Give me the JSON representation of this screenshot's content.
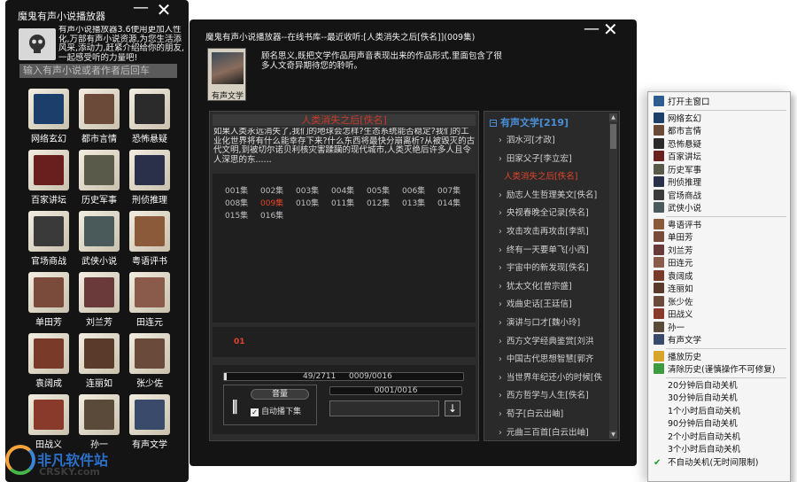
{
  "launcher": {
    "title": "魔鬼有声小说播放器",
    "intro": "有声小说播放器3.6使用更加人性化,万部有声小说资源,为您生活添风采,添动力,赶紧介绍给你的朋友,一起感受听的力量吧!",
    "search_placeholder": "输入有声小说或者作者后回车",
    "categories": [
      {
        "label": "网络玄幻",
        "icon": "fantasy-icon",
        "color": "#1b3f6a"
      },
      {
        "label": "都市言情",
        "icon": "romance-icon",
        "color": "#6b4a3a"
      },
      {
        "label": "恐怖悬疑",
        "icon": "skull-icon",
        "color": "#2b2b2b"
      },
      {
        "label": "百家讲坛",
        "icon": "lecture-icon",
        "color": "#6a1f1f"
      },
      {
        "label": "历史军事",
        "icon": "history-icon",
        "color": "#5a5a4a"
      },
      {
        "label": "刑侦推理",
        "icon": "police-icon",
        "color": "#2a2f4a"
      },
      {
        "label": "官场商战",
        "icon": "business-icon",
        "color": "#3a3a3a"
      },
      {
        "label": "武侠小说",
        "icon": "martial-arts-icon",
        "color": "#4a5a5a"
      },
      {
        "label": "粤语评书",
        "icon": "cantonese-icon",
        "color": "#8a5a3a"
      },
      {
        "label": "单田芳",
        "icon": "narrator-icon",
        "color": "#7a4a3a"
      },
      {
        "label": "刘兰芳",
        "icon": "narrator-icon",
        "color": "#6a3a3a"
      },
      {
        "label": "田连元",
        "icon": "narrator-icon",
        "color": "#8a5a4a"
      },
      {
        "label": "袁阔成",
        "icon": "narrator-icon",
        "color": "#7a3a2a"
      },
      {
        "label": "连丽如",
        "icon": "narrator-icon",
        "color": "#5a3a2a"
      },
      {
        "label": "张少佐",
        "icon": "narrator-icon",
        "color": "#6a4a3a"
      },
      {
        "label": "田战义",
        "icon": "narrator-icon",
        "color": "#8a3a2a"
      },
      {
        "label": "孙一",
        "icon": "narrator-icon",
        "color": "#5a4a3a"
      },
      {
        "label": "有声文学",
        "icon": "literature-icon",
        "color": "#3a4a6a"
      }
    ]
  },
  "player": {
    "title": "魔鬼有声小说播放器--在线书库--最近收听:[人类消失之后[佚名]](009集)",
    "cover_label": "有声文学",
    "description": "顾名思义,既把文学作品用声音表现出来的作品形式.里面包含了很多人文奇异期待您的聆听。",
    "book_title": "人类消失之后[佚名]",
    "book_desc": "如果人类永远消失了,我们的地球会怎样?生态系统能否稳定?我们的工业化世界将有什么能幸存下来?什么东西将最快分崩离析?从被毁灭的古代文明,到被切尔诺贝利核灾害蹂躏的现代城市,人类灭绝后许多人且令人深思的东......",
    "episodes": [
      "001集",
      "002集",
      "003集",
      "004集",
      "005集",
      "006集",
      "007集",
      "008集",
      "009集",
      "010集",
      "011集",
      "012集",
      "013集",
      "014集",
      "015集",
      "016集"
    ],
    "current_episode_index": 8,
    "current_marker": "01",
    "progress_total": "49/2711",
    "progress_eps": "0009/0016",
    "volume_label": "音量",
    "auto_next_label": "自动播下集",
    "auto_next_checked": true,
    "download_progress": "0001/0016",
    "tree_root": "有声文学[219]",
    "tree_items": [
      "泗水河[才政]",
      "田家父子[李立宏]",
      "人类消失之后[佚名]",
      "励志人生哲理美文[佚名]",
      "央视春晚全记录[佚名]",
      "攻击攻击再攻击[李凯]",
      "终有一天要单飞[小西]",
      "宇宙中的新发现[佚名]",
      "犹太文化[曾宗盛]",
      "戏曲史话[王廷信]",
      "演讲与口才[魏小玲]",
      "西方文学经典鉴赏[刘洪",
      "中国古代思想智慧[郭齐",
      "当世界年纪还小的时候[佚",
      "西方哲学与人生[佚名]",
      "荀子[白云出岫]",
      "元曲三百首[白云出岫]"
    ],
    "tree_active_index": 2
  },
  "menu": {
    "open_main": "打开主窗口",
    "categories": [
      "网络玄幻",
      "都市言情",
      "恐怖悬疑",
      "百家讲坛",
      "历史军事",
      "刑侦推理",
      "官场商战",
      "武侠小说"
    ],
    "category_colors": [
      "#1b3f6a",
      "#6b4a3a",
      "#2b2b2b",
      "#6a1f1f",
      "#5a5a4a",
      "#2a2f4a",
      "#3a3a3a",
      "#4a5a5a"
    ],
    "narrators": [
      "粤语评书",
      "单田芳",
      "刘兰芳",
      "田连元",
      "袁阔成",
      "连丽如",
      "张少佐",
      "田战义",
      "孙一",
      "有声文学"
    ],
    "narrator_colors": [
      "#8a5a3a",
      "#7a4a3a",
      "#6a3a3a",
      "#8a5a4a",
      "#7a3a2a",
      "#5a3a2a",
      "#6a4a3a",
      "#8a3a2a",
      "#5a4a3a",
      "#3a4a6a"
    ],
    "play_history": "播放历史",
    "clear_history": "清除历史(谨慎操作不可修复)",
    "shutdown": [
      "20分钟后自动关机",
      "30分钟后自动关机",
      "1个小时后自动关机",
      "90分钟后自动关机",
      "2个小时后自动关机",
      "3个小时后自动关机",
      "不自动关机(无时间限制)"
    ],
    "shutdown_checked_index": 6
  },
  "watermark": {
    "brand": "非凡软件站",
    "site": "CRSKY.com"
  }
}
